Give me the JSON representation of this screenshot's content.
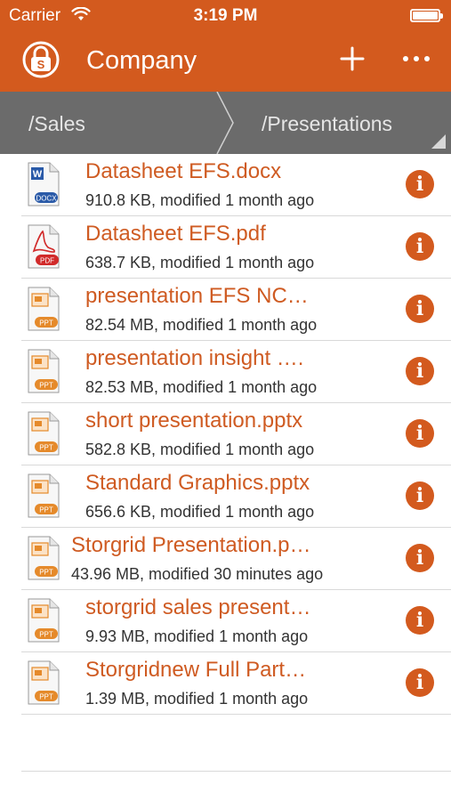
{
  "status": {
    "carrier": "Carrier",
    "time": "3:19 PM"
  },
  "nav": {
    "title": "Company"
  },
  "breadcrumb": {
    "first": "/Sales",
    "second": "/Presentations"
  },
  "files": [
    {
      "name": "Datasheet EFS.docx",
      "meta": "910.8 KB, modified 1 month ago",
      "type": "docx",
      "badge": "DOCX"
    },
    {
      "name": "Datasheet EFS.pdf",
      "meta": "638.7 KB, modified 1 month ago",
      "type": "pdf",
      "badge": "PDF"
    },
    {
      "name": "presentation EFS NC…",
      "meta": "82.54 MB, modified 1 month ago",
      "type": "ppt",
      "badge": "PPT"
    },
    {
      "name": "presentation insight ….",
      "meta": "82.53 MB, modified 1 month ago",
      "type": "ppt",
      "badge": "PPT"
    },
    {
      "name": "short presentation.pptx",
      "meta": "582.8 KB, modified 1 month ago",
      "type": "ppt",
      "badge": "PPT"
    },
    {
      "name": "Standard Graphics.pptx",
      "meta": "656.6 KB, modified 1 month ago",
      "type": "ppt",
      "badge": "PPT"
    },
    {
      "name": "Storgrid Presentation.p…",
      "meta": "43.96 MB, modified 30 minutes ago",
      "type": "ppt",
      "badge": "PPT"
    },
    {
      "name": "storgrid sales present…",
      "meta": "9.93 MB, modified 1 month ago",
      "type": "ppt",
      "badge": "PPT"
    },
    {
      "name": "Storgridnew Full Part…",
      "meta": "1.39 MB, modified 1 month ago",
      "type": "ppt",
      "badge": "PPT"
    }
  ],
  "icons": {
    "wifi": "wifi-icon",
    "battery": "battery-icon",
    "logo": "lock-logo-icon",
    "add": "plus-icon",
    "more": "more-dots-icon",
    "info": "info-icon",
    "info_glyph": "i"
  },
  "colors": {
    "accent": "#d35a1e",
    "breadcrumb_bg": "#6b6b6b",
    "file_name": "#cf5b22"
  }
}
